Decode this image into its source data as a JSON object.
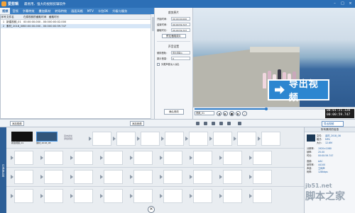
{
  "titlebar": {
    "app": "爱剪辑",
    "title": "最易用、强大的视频剪辑软件"
  },
  "tabs": [
    "视频",
    "音频",
    "字幕特效",
    "叠加素材",
    "转场特效",
    "画面风格",
    "MTV",
    "卡拉OK",
    "升级与服务"
  ],
  "filelist": {
    "headers": [
      "序号",
      "文件名",
      "在原视频的截取时间",
      "截取时长"
    ],
    "rows": [
      {
        "idx": "1",
        "name": "新建视频_01",
        "range": "00:00:00.000 - 00:00:02.000",
        "duration": "00:00:02.000"
      },
      {
        "idx": "2",
        "name": "素材_2018_08",
        "range": "00:00:00.000 - 00:00:59.747",
        "duration": "00:00:59.747"
      }
    ]
  },
  "settings": {
    "section_clip": "裁剪原片",
    "start_label": "开始时间：",
    "start_value": "00:00:00.000",
    "end_label": "结束时间：",
    "end_value": "00:00:59.747",
    "dur_label": "截取时长：",
    "dur_value": "00:00:59.747",
    "preview_btn": "预览/截取原片",
    "section_audio": "声音设置",
    "track_label": "使用音轨：",
    "track_value": "原片音轨1",
    "volume_label": "原片音量：",
    "volume_value": "0",
    "checkbox_label": "头尾声音淡入淡出",
    "confirm_btn": "确认修改"
  },
  "preview": {
    "export_label": "导出视频"
  },
  "controls": {
    "clip_select": "视频_01",
    "btn_prev": "◀",
    "btn_play": "▶",
    "btn_stop": "■",
    "btn_next": "▶",
    "btn_vol": "♪",
    "time_current": "00:01:21.320",
    "time_total": "00:00:59.747",
    "progress": 0.55
  },
  "tl_toolbar": {
    "add_video": "添加视频",
    "add_music": "添加音频",
    "export": "导出视频"
  },
  "timeline": {
    "track_label": "已添加片段",
    "clip1_label": "新建视频_01",
    "clip2_label": "素材_2018_08",
    "hint_line1": "双击此处",
    "hint_line2": "添加视频"
  },
  "props": {
    "head": "所有素材的信息",
    "name_k": "文件:",
    "name_v": "素材_2018_08",
    "format_k": "格式:",
    "format_v": "MP4",
    "size_k": "大小:",
    "size_v": "12.6M",
    "res_k": "分辨率:",
    "res_v": "1920×1080",
    "fps_k": "帧率:",
    "fps_v": "25.00",
    "dur_k": "时长:",
    "dur_v": "00:00:59.747",
    "audio_k": "音频:",
    "audio_v": "AAC",
    "rate_k": "采样率:",
    "rate_v": "44100",
    "ch_k": "声道:",
    "ch_v": "立体声",
    "bit_k": "码率:",
    "bit_v": "128kbps"
  },
  "watermark": {
    "site": "jb51.net",
    "name": "脚本之家"
  }
}
